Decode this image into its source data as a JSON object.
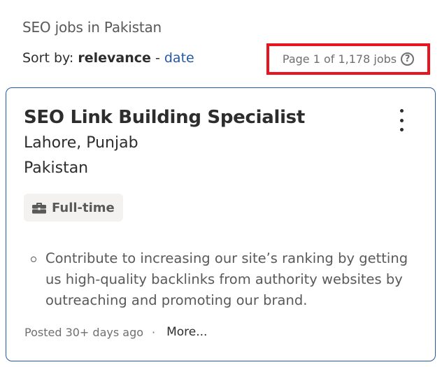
{
  "search": {
    "title": "SEO jobs in Pakistan"
  },
  "sort": {
    "label": "Sort by:",
    "active": "relevance",
    "separator": "-",
    "alternate": "date"
  },
  "pagination": {
    "text": "Page 1 of 1,178 jobs",
    "help_icon": "?"
  },
  "job": {
    "title": "SEO Link Building Specialist",
    "location_line1": "Lahore, Punjab",
    "location_line2": "Pakistan",
    "job_type": "Full-time",
    "snippet": "Contribute to increasing our site’s ranking by getting us high-quality backlinks from authority websites by outreaching and promoting our brand.",
    "posted": "Posted 30+ days ago",
    "dot": "·",
    "more": "More..."
  },
  "icons": {
    "help": "question-circle-icon",
    "menu": "kebab-menu-icon",
    "job_type": "briefcase-icon",
    "bullet": "circle-bullet-icon"
  },
  "colors": {
    "link": "#2557a7",
    "highlight_border": "#e8141f",
    "card_border": "#2557a7",
    "badge_bg": "#f3f2f1"
  }
}
